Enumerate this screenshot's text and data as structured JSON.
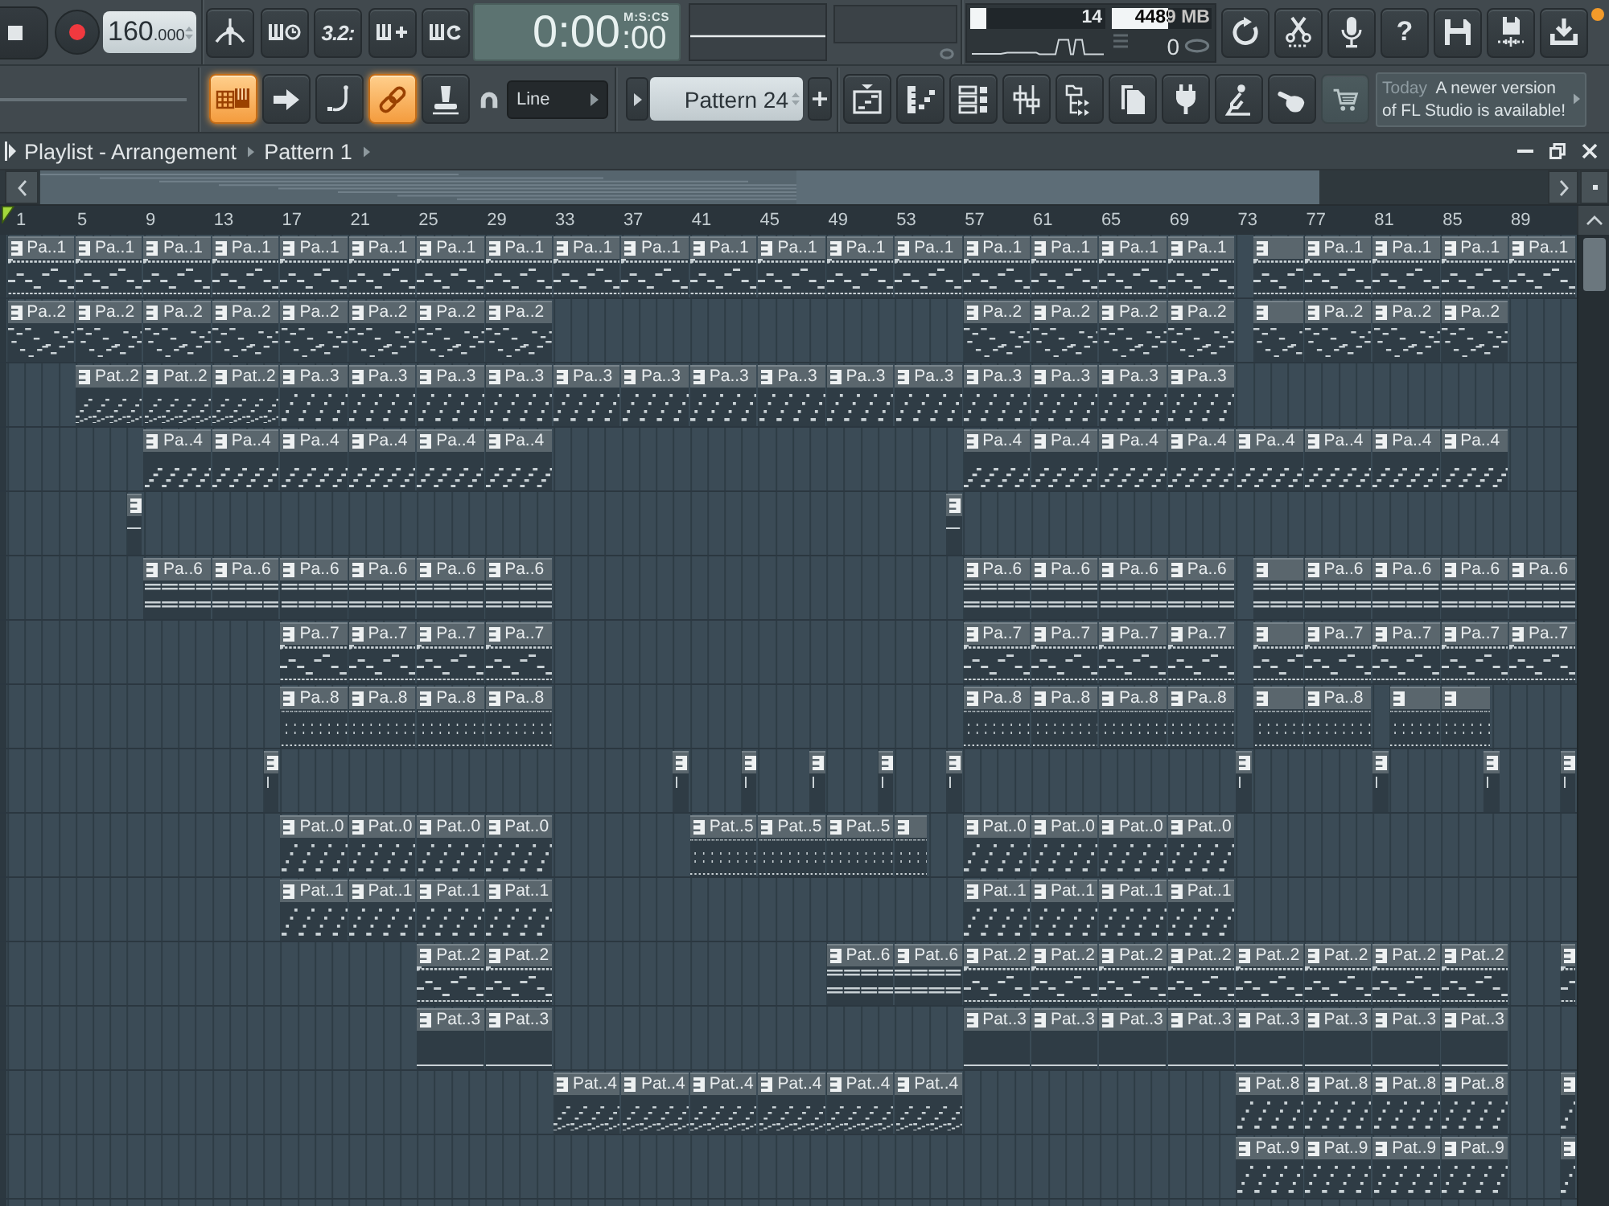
{
  "transport": {
    "tempo": {
      "whole": "160",
      "fraction": ".000"
    },
    "countdown_label": "3.2:",
    "time": {
      "main": "0:00",
      "sub": ":00",
      "format": "M:S:CS"
    }
  },
  "monitor": {
    "cpu": {
      "value": "14",
      "level": 0.12
    },
    "memory": {
      "value": "4489 MB",
      "level": 0.56
    },
    "polyphony": {
      "value": "0"
    }
  },
  "help_label": "?",
  "tool_buttons": [
    {
      "on": true
    },
    {
      "on": false
    },
    {
      "on": false
    },
    {
      "on": true
    },
    {
      "on": false
    }
  ],
  "snap": {
    "value": "Line"
  },
  "pattern_selector": {
    "value": "Pattern 24"
  },
  "news": {
    "date": "Today",
    "message": "A newer version of FL Studio is available!"
  },
  "playlist": {
    "title": "Playlist - Arrangement",
    "pattern": "Pattern 1",
    "ruler": [
      "1",
      "5",
      "9",
      "13",
      "17",
      "21",
      "25",
      "29",
      "33",
      "37",
      "41",
      "45",
      "49",
      "53",
      "57",
      "61",
      "65",
      "69",
      "73",
      "77",
      "81",
      "85",
      "89"
    ],
    "tracks": [
      {
        "clips": [
          {
            "label": "Pa..1",
            "kind": "steps"
          },
          {
            "label": "Pa..1",
            "kind": "steps"
          },
          {
            "label": "Pa..1",
            "kind": "steps"
          },
          {
            "label": "Pa..1",
            "kind": "steps"
          },
          {
            "label": "Pa..1",
            "kind": "steps"
          },
          {
            "label": "Pa..1",
            "kind": "steps"
          },
          {
            "label": "Pa..1",
            "kind": "steps"
          },
          {
            "label": "Pa..1",
            "kind": "steps"
          },
          {
            "label": "Pa..1",
            "kind": "steps"
          },
          {
            "label": "Pa..1",
            "kind": "steps"
          },
          {
            "label": "Pa..1",
            "kind": "steps"
          },
          {
            "label": "Pa..1",
            "kind": "steps"
          },
          {
            "label": "Pa..1",
            "kind": "steps"
          },
          {
            "label": "Pa..1",
            "kind": "steps"
          },
          {
            "label": "Pa..1",
            "kind": "steps"
          },
          {
            "label": "Pa..1",
            "kind": "steps"
          },
          {
            "label": "Pa..1",
            "kind": "steps"
          },
          {
            "label": "Pa..1",
            "kind": "steps"
          },
          {
            "kind": "steps"
          },
          {
            "label": "Pa..1",
            "kind": "steps"
          },
          {
            "label": "Pa..1",
            "kind": "steps"
          },
          {
            "label": "Pa..1",
            "kind": "steps"
          },
          {
            "label": "Pa..1",
            "kind": "steps"
          }
        ]
      },
      {
        "clips": [
          {
            "label": "Pa..2",
            "kind": "dashes"
          },
          {
            "label": "Pa..2",
            "kind": "dashes"
          },
          {
            "label": "Pa..2",
            "kind": "dashes"
          },
          {
            "label": "Pa..2",
            "kind": "dashes"
          },
          {
            "label": "Pa..2",
            "kind": "dashes"
          },
          {
            "label": "Pa..2",
            "kind": "dashes"
          },
          {
            "label": "Pa..2",
            "kind": "dashes"
          },
          {
            "label": "Pa..2",
            "kind": "dashes"
          },
          {
            "label": "Pa..2",
            "kind": "dashes"
          },
          {
            "label": "Pa..2",
            "kind": "dashes"
          },
          {
            "label": "Pa..2",
            "kind": "dashes"
          },
          {
            "label": "Pa..2",
            "kind": "dashes"
          },
          {
            "kind": "dashes"
          },
          {
            "label": "Pa..2",
            "kind": "dashes"
          },
          {
            "label": "Pa..2",
            "kind": "dashes"
          },
          {
            "label": "Pa..2",
            "kind": "dashes"
          }
        ]
      },
      {
        "clips": [
          {
            "label": "Pat..2",
            "kind": "rise"
          },
          {
            "label": "Pat..2",
            "kind": "rise"
          },
          {
            "label": "Pat..2",
            "kind": "rise"
          },
          {
            "label": "Pa..3",
            "kind": "dots"
          },
          {
            "label": "Pa..3",
            "kind": "dots"
          },
          {
            "label": "Pa..3",
            "kind": "dots"
          },
          {
            "label": "Pa..3",
            "kind": "dots"
          },
          {
            "label": "Pa..3",
            "kind": "dots"
          },
          {
            "label": "Pa..3",
            "kind": "dots"
          },
          {
            "label": "Pa..3",
            "kind": "dots"
          },
          {
            "label": "Pa..3",
            "kind": "dots"
          },
          {
            "label": "Pa..3",
            "kind": "dots"
          },
          {
            "label": "Pa..3",
            "kind": "dots"
          },
          {
            "label": "Pa..3",
            "kind": "dots"
          },
          {
            "label": "Pa..3",
            "kind": "dots"
          },
          {
            "label": "Pa..3",
            "kind": "dots"
          },
          {
            "label": "Pa..3",
            "kind": "dots"
          }
        ]
      },
      {
        "clips": [
          {
            "label": "Pa..4",
            "kind": "ramp"
          },
          {
            "label": "Pa..4",
            "kind": "ramp"
          },
          {
            "label": "Pa..4",
            "kind": "ramp"
          },
          {
            "label": "Pa..4",
            "kind": "ramp"
          },
          {
            "label": "Pa..4",
            "kind": "ramp"
          },
          {
            "label": "Pa..4",
            "kind": "ramp"
          },
          {
            "label": "Pa..4",
            "kind": "ramp"
          },
          {
            "label": "Pa..4",
            "kind": "ramp"
          },
          {
            "label": "Pa..4",
            "kind": "ramp"
          },
          {
            "label": "Pa..4",
            "kind": "ramp"
          },
          {
            "label": "Pa..4",
            "kind": "ramp"
          },
          {
            "label": "Pa..4",
            "kind": "ramp"
          },
          {
            "label": "Pa..4",
            "kind": "ramp"
          },
          {
            "label": "Pa..4",
            "kind": "ramp"
          }
        ]
      },
      {
        "clips": [
          {
            "kind": "blip"
          },
          {
            "kind": "blip"
          }
        ]
      },
      {
        "clips": [
          {
            "label": "Pa..6",
            "kind": "chords"
          },
          {
            "label": "Pa..6",
            "kind": "chords"
          },
          {
            "label": "Pa..6",
            "kind": "chords"
          },
          {
            "label": "Pa..6",
            "kind": "chords"
          },
          {
            "label": "Pa..6",
            "kind": "chords"
          },
          {
            "label": "Pa..6",
            "kind": "chords"
          },
          {
            "label": "Pa..6",
            "kind": "chords"
          },
          {
            "label": "Pa..6",
            "kind": "chords"
          },
          {
            "label": "Pa..6",
            "kind": "chords"
          },
          {
            "label": "Pa..6",
            "kind": "chords"
          },
          {
            "kind": "chords"
          },
          {
            "label": "Pa..6",
            "kind": "chords"
          },
          {
            "label": "Pa..6",
            "kind": "chords"
          },
          {
            "label": "Pa..6",
            "kind": "chords"
          },
          {
            "label": "Pa..6",
            "kind": "chords"
          }
        ]
      },
      {
        "clips": [
          {
            "label": "Pa..7",
            "kind": "steps"
          },
          {
            "label": "Pa..7",
            "kind": "steps"
          },
          {
            "label": "Pa..7",
            "kind": "steps"
          },
          {
            "label": "Pa..7",
            "kind": "steps"
          },
          {
            "label": "Pa..7",
            "kind": "steps"
          },
          {
            "label": "Pa..7",
            "kind": "steps"
          },
          {
            "label": "Pa..7",
            "kind": "steps"
          },
          {
            "label": "Pa..7",
            "kind": "steps"
          },
          {
            "kind": "steps"
          },
          {
            "label": "Pa..7",
            "kind": "steps"
          },
          {
            "label": "Pa..7",
            "kind": "steps"
          },
          {
            "label": "Pa..7",
            "kind": "steps"
          },
          {
            "label": "Pa..7",
            "kind": "steps"
          }
        ]
      },
      {
        "clips": [
          {
            "label": "Pa..8",
            "kind": "ticks"
          },
          {
            "label": "Pa..8",
            "kind": "ticks"
          },
          {
            "label": "Pa..8",
            "kind": "ticks"
          },
          {
            "label": "Pa..8",
            "kind": "ticks"
          },
          {
            "label": "Pa..8",
            "kind": "ticks"
          },
          {
            "label": "Pa..8",
            "kind": "ticks"
          },
          {
            "label": "Pa..8",
            "kind": "ticks"
          },
          {
            "label": "Pa..8",
            "kind": "ticks"
          },
          {
            "kind": "ticks"
          },
          {
            "label": "Pa..8",
            "kind": "ticks"
          },
          {
            "kind": "ticks"
          },
          {
            "kind": "ticks"
          }
        ]
      },
      {
        "clips": [
          {
            "kind": "tick"
          },
          {
            "kind": "tick"
          },
          {
            "kind": "tick"
          },
          {
            "kind": "tick"
          },
          {
            "kind": "tick"
          },
          {
            "kind": "tick"
          },
          {
            "kind": "tick"
          },
          {
            "kind": "tick"
          },
          {
            "kind": "tick"
          },
          {
            "kind": "tick"
          }
        ]
      },
      {
        "clips": [
          {
            "label": "Pat..0",
            "kind": "dots"
          },
          {
            "label": "Pat..0",
            "kind": "dots"
          },
          {
            "label": "Pat..0",
            "kind": "dots"
          },
          {
            "label": "Pat..0",
            "kind": "dots"
          },
          {
            "label": "Pat..5",
            "kind": "ticks"
          },
          {
            "label": "Pat..5",
            "kind": "ticks"
          },
          {
            "label": "Pat..5",
            "kind": "ticks"
          },
          {
            "kind": "ticks"
          },
          {
            "label": "Pat..0",
            "kind": "dots"
          },
          {
            "label": "Pat..0",
            "kind": "dots"
          },
          {
            "label": "Pat..0",
            "kind": "dots"
          },
          {
            "label": "Pat..0",
            "kind": "dots"
          }
        ]
      },
      {
        "clips": [
          {
            "label": "Pat..1",
            "kind": "dots"
          },
          {
            "label": "Pat..1",
            "kind": "dots"
          },
          {
            "label": "Pat..1",
            "kind": "dots"
          },
          {
            "label": "Pat..1",
            "kind": "dots"
          },
          {
            "label": "Pat..1",
            "kind": "dots"
          },
          {
            "label": "Pat..1",
            "kind": "dots"
          },
          {
            "label": "Pat..1",
            "kind": "dots"
          },
          {
            "label": "Pat..1",
            "kind": "dots"
          }
        ]
      },
      {
        "clips": [
          {
            "label": "Pat..2",
            "kind": "steps"
          },
          {
            "label": "Pat..2",
            "kind": "steps"
          },
          {
            "label": "Pat..6",
            "kind": "chords"
          },
          {
            "label": "Pat..6",
            "kind": "chords"
          },
          {
            "label": "Pat..2",
            "kind": "steps"
          },
          {
            "label": "Pat..2",
            "kind": "steps"
          },
          {
            "label": "Pat..2",
            "kind": "steps"
          },
          {
            "label": "Pat..2",
            "kind": "steps"
          },
          {
            "label": "Pat..2",
            "kind": "steps"
          },
          {
            "label": "Pat..2",
            "kind": "steps"
          },
          {
            "label": "Pat..2",
            "kind": "steps"
          },
          {
            "label": "Pat..2",
            "kind": "steps"
          },
          {
            "kind": "steps"
          }
        ]
      },
      {
        "clips": [
          {
            "label": "Pat..3",
            "kind": "line"
          },
          {
            "label": "Pat..3",
            "kind": "line"
          },
          {
            "label": "Pat..3",
            "kind": "line"
          },
          {
            "label": "Pat..3",
            "kind": "line"
          },
          {
            "label": "Pat..3",
            "kind": "line"
          },
          {
            "label": "Pat..3",
            "kind": "line"
          },
          {
            "label": "Pat..3",
            "kind": "line"
          },
          {
            "label": "Pat..3",
            "kind": "line"
          },
          {
            "label": "Pat..3",
            "kind": "line"
          },
          {
            "label": "Pat..3",
            "kind": "line"
          }
        ]
      },
      {
        "clips": [
          {
            "label": "Pat..4",
            "kind": "rise"
          },
          {
            "label": "Pat..4",
            "kind": "rise"
          },
          {
            "label": "Pat..4",
            "kind": "rise"
          },
          {
            "label": "Pat..4",
            "kind": "rise"
          },
          {
            "label": "Pat..4",
            "kind": "rise"
          },
          {
            "label": "Pat..4",
            "kind": "rise"
          },
          {
            "label": "Pat..8",
            "kind": "dots"
          },
          {
            "label": "Pat..8",
            "kind": "dots"
          },
          {
            "label": "Pat..8",
            "kind": "dots"
          },
          {
            "label": "Pat..8",
            "kind": "dots"
          },
          {
            "kind": "dots"
          }
        ]
      },
      {
        "clips": [
          {
            "label": "Pat..9",
            "kind": "dots"
          },
          {
            "label": "Pat..9",
            "kind": "dots"
          },
          {
            "label": "Pat..9",
            "kind": "dots"
          },
          {
            "label": "Pat..9",
            "kind": "dots"
          },
          {
            "kind": "dots"
          }
        ]
      }
    ]
  }
}
